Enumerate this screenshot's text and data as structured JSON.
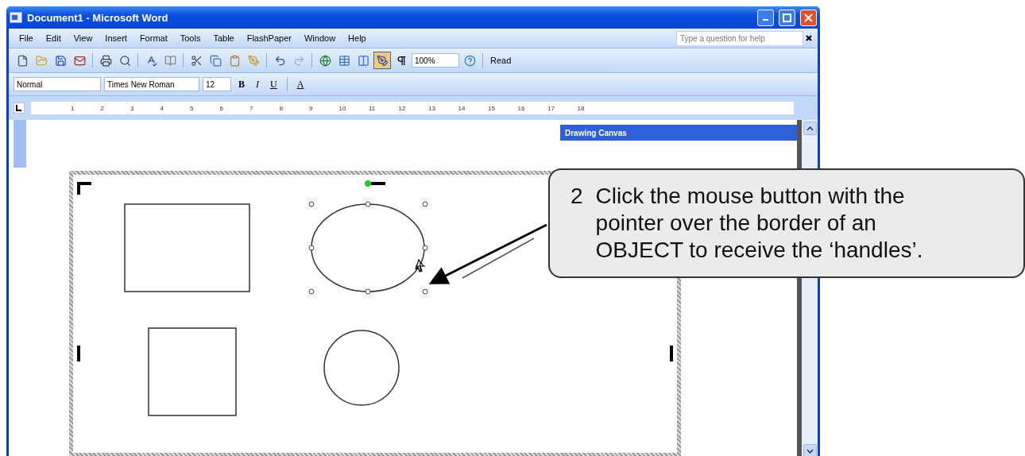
{
  "window": {
    "title": "Document1 - Microsoft Word"
  },
  "menu": [
    "File",
    "Edit",
    "View",
    "Insert",
    "Format",
    "Tools",
    "Table",
    "FlashPaper",
    "Window",
    "Help"
  ],
  "help_box": {
    "placeholder": "Type a question for help"
  },
  "standard_toolbar": {
    "zoom": "100%",
    "read_button": "Read",
    "drawing_selected": true
  },
  "formatting_toolbar": {
    "style": "Normal",
    "font": "Times New Roman",
    "size": "12",
    "bold": "B",
    "italic": "I",
    "underline": "U",
    "font_color": "A"
  },
  "ruler": [
    "1",
    "2",
    "3",
    "4",
    "5",
    "6",
    "7",
    "8",
    "9",
    "10",
    "11",
    "12",
    "13",
    "14",
    "15",
    "16",
    "17",
    "18"
  ],
  "task_pane": {
    "title": "Drawing Canvas"
  },
  "callout": {
    "step": "2",
    "text": "Click the mouse button with the pointer over the border of an OBJECT to receive the ‘handles’."
  }
}
